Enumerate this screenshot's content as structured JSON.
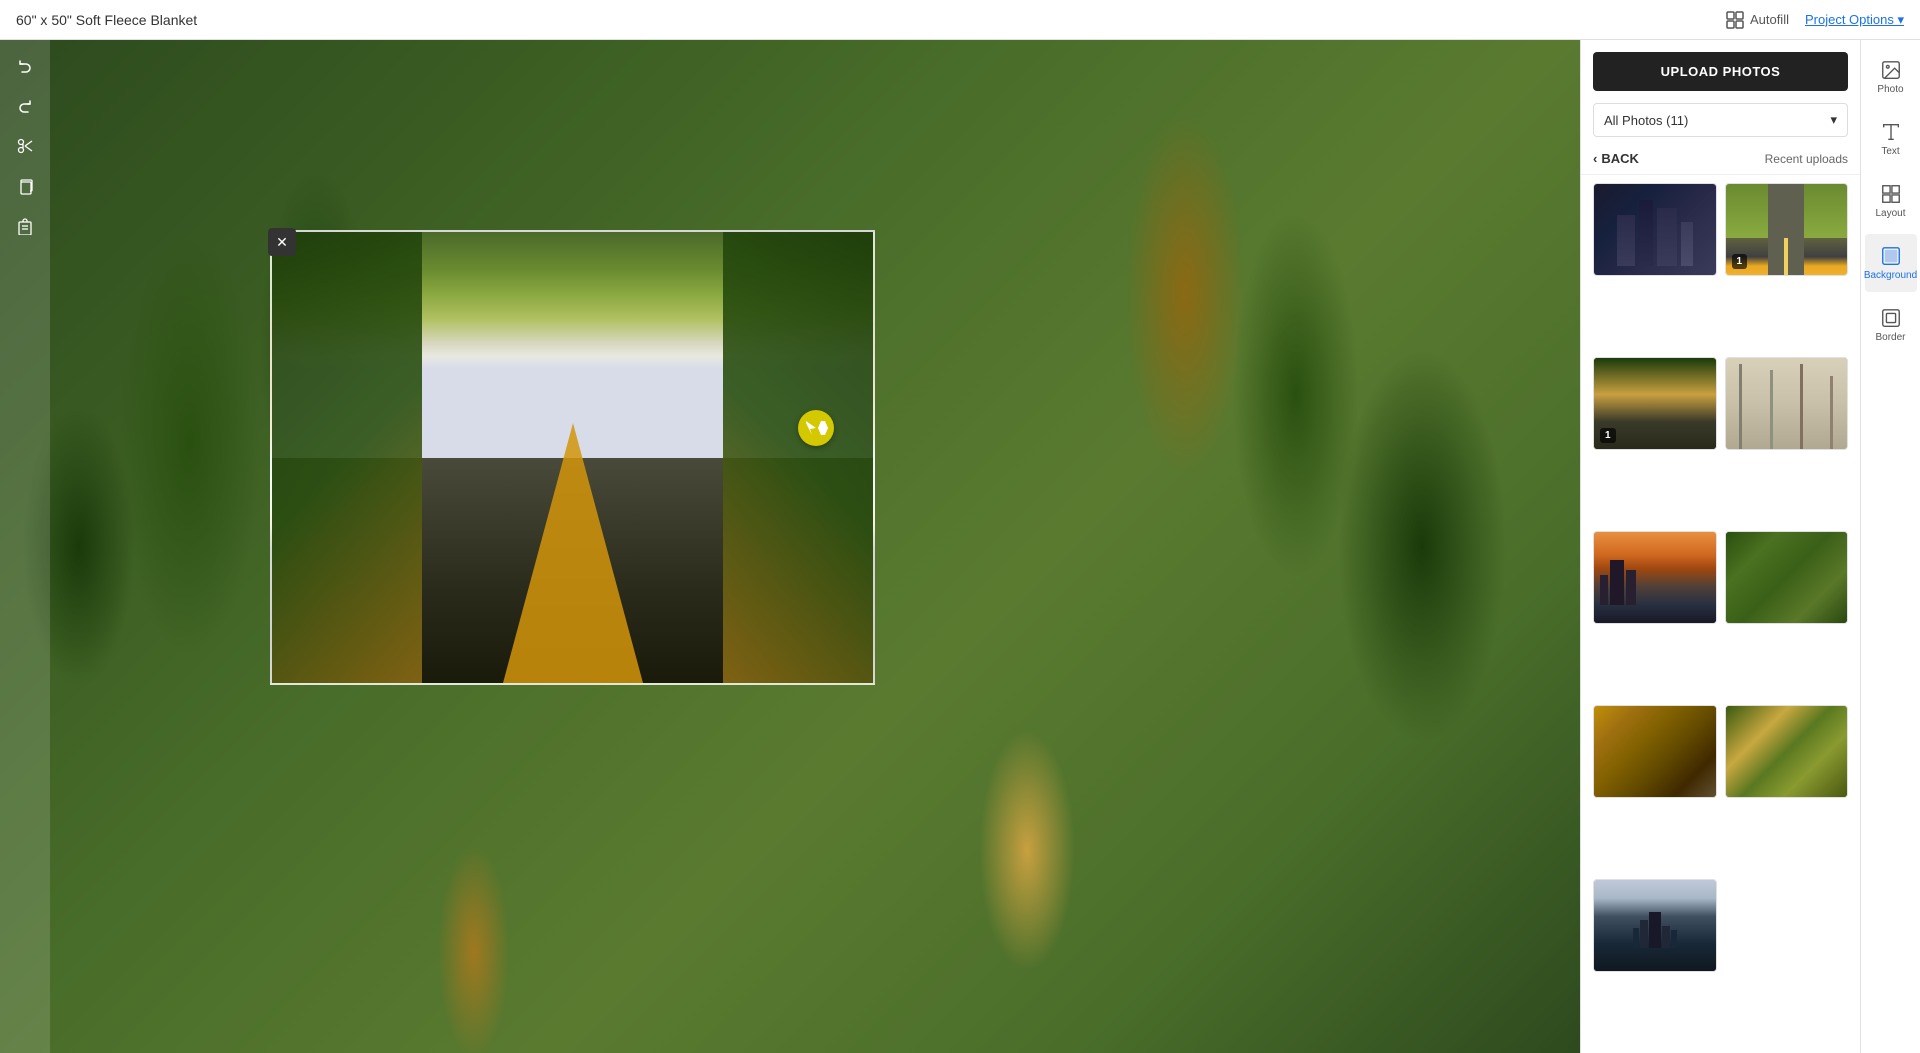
{
  "topbar": {
    "title": "60\" x 50\" Soft Fleece Blanket",
    "autofill_label": "Autofill",
    "project_options_label": "Project Options ▾"
  },
  "toolbar": {
    "undo_label": "Undo",
    "redo_label": "Redo",
    "cut_label": "Cut",
    "copy_label": "Copy",
    "paste_label": "Paste"
  },
  "photos_panel": {
    "upload_btn_label": "UPLOAD PHOTOS",
    "dropdown_label": "All Photos (11)",
    "back_label": "BACK",
    "recent_uploads_label": "Recent uploads",
    "photos": [
      {
        "id": "photo-1",
        "style_class": "photo-buildings-dark",
        "badge": ""
      },
      {
        "id": "photo-2",
        "style_class": "photo-road-top",
        "badge": "1"
      },
      {
        "id": "photo-3",
        "style_class": "photo-forest-autumn",
        "badge": "1"
      },
      {
        "id": "photo-4",
        "style_class": "photo-birch-trees",
        "badge": ""
      },
      {
        "id": "photo-5",
        "style_class": "photo-city-sunset",
        "badge": ""
      },
      {
        "id": "photo-6",
        "style_class": "photo-forest-aerial",
        "badge": ""
      },
      {
        "id": "photo-7",
        "style_class": "photo-leaves-closeup",
        "badge": ""
      },
      {
        "id": "photo-8",
        "style_class": "photo-aerial-forest",
        "badge": ""
      },
      {
        "id": "photo-9",
        "style_class": "photo-city-skyline",
        "badge": ""
      }
    ]
  },
  "right_sidebar": {
    "items": [
      {
        "id": "photos",
        "label": "Photo",
        "active": false
      },
      {
        "id": "text",
        "label": "Text",
        "active": false
      },
      {
        "id": "layout",
        "label": "Layout",
        "active": false
      },
      {
        "id": "background",
        "label": "Background",
        "active": true
      },
      {
        "id": "border",
        "label": "Border",
        "active": false
      }
    ]
  },
  "canvas": {
    "close_label": "✕"
  }
}
